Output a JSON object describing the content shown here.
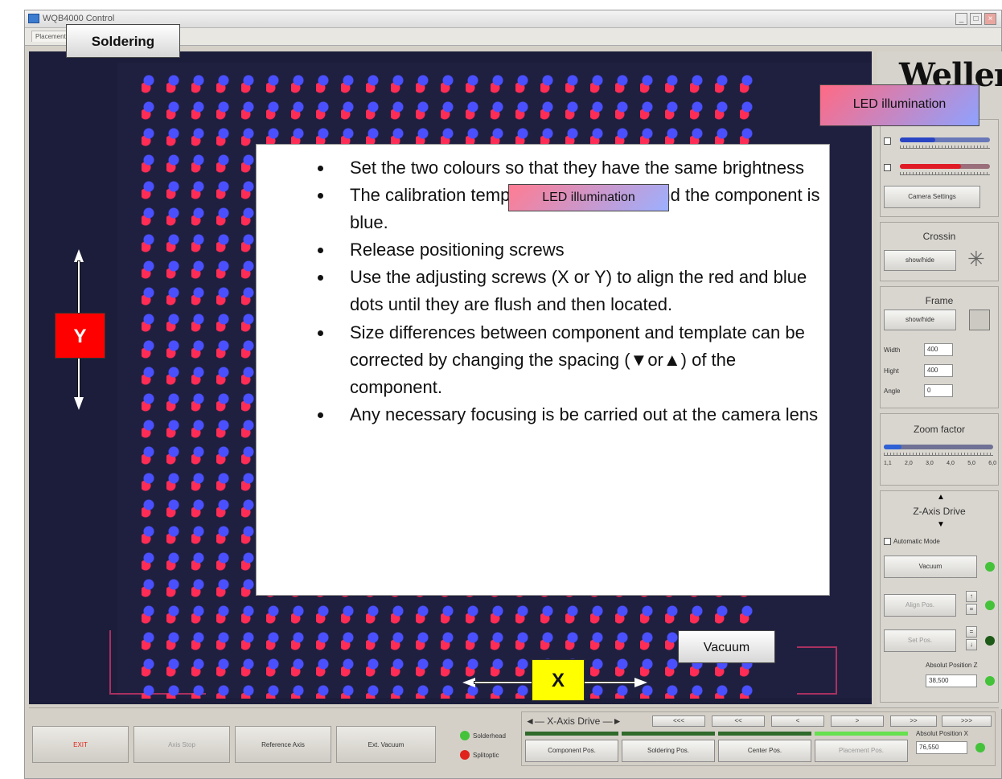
{
  "window": {
    "title": "WQB4000 Control"
  },
  "tabs": {
    "placement": "Placement"
  },
  "callouts": {
    "soldering": "Soldering",
    "led_top": "LED illumination",
    "led_mid": "LED illumination",
    "vacuum": "Vacuum",
    "x_axis": "X",
    "y_axis": "Y"
  },
  "instructions": {
    "items": [
      "Set the two colours so that they have the same brightness",
      "The calibration template becomes red and the component is blue.",
      "Release positioning screws",
      "Use the adjusting screws (X or Y) to align the red and blue dots until they are flush and then located.",
      "Size differences between component and template can be corrected by changing the spacing (▼or▲) of the component.",
      "Any necessary focusing is be carried out at the camera lens"
    ]
  },
  "panel": {
    "logo": "Weller",
    "camera_settings": "Camera Settings",
    "crossin": {
      "title": "Crossin",
      "button": "show/hide"
    },
    "frame": {
      "title": "Frame",
      "button": "show/hide",
      "width_label": "Width",
      "width_value": "400",
      "hight_label": "Hight",
      "hight_value": "400",
      "angle_label": "Angle",
      "angle_value": "0"
    },
    "zoom": {
      "title": "Zoom factor",
      "ticks": [
        "1,1",
        "2,0",
        "3,0",
        "4,0",
        "5,0",
        "6,0"
      ]
    },
    "zaxis": {
      "title": "Z-Axis Drive",
      "automatic_mode": "Automatic Mode",
      "vacuum": "Vacuum",
      "align_pos": "Align Pos.",
      "set_pos": "Set Pos.",
      "abs_label": "Absolut Position Z",
      "abs_value": "38,500"
    }
  },
  "bottom": {
    "exit": "EXIT",
    "axis_stop": "Axis Stop",
    "reference_axis": "Reference Axis",
    "ext_vacuum": "Ext. Vacuum",
    "solderhead": "Solderhead",
    "splitoptic": "Splitoptic",
    "xaxis_title": "X-Axis Drive",
    "nav": [
      "<<<",
      "<<",
      "<",
      ">",
      ">>",
      ">>>"
    ],
    "positions": [
      "Component Pos.",
      "Soldering Pos.",
      "Center Pos.",
      "Placement Pos."
    ],
    "abs_label": "Absolut Position X",
    "abs_value": "76,550"
  },
  "colors": {
    "led_green": "#44c23a",
    "led_red": "#e0231b",
    "led_dark": "#1d5a18"
  }
}
